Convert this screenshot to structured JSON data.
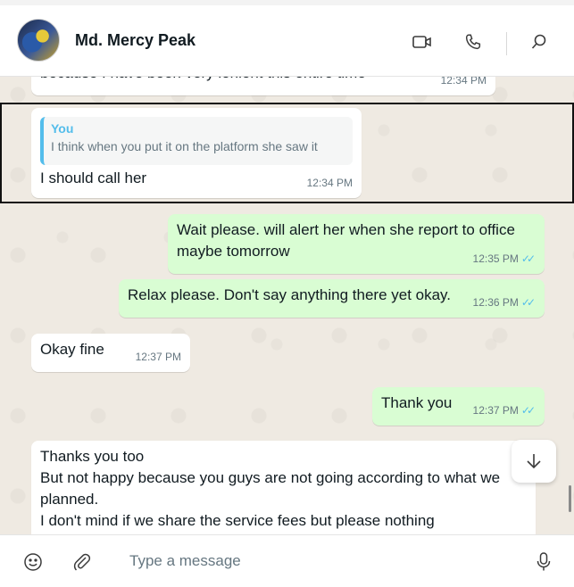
{
  "header": {
    "contact_name": "Md. Mercy Peak",
    "icons": [
      "video-call-icon",
      "voice-call-icon",
      "search-icon"
    ]
  },
  "messages": [
    {
      "direction": "in",
      "text": "because I have been very lenient this entire time",
      "time": "12:34 PM"
    },
    {
      "direction": "in",
      "quote_author": "You",
      "quote_text": "I think when you put it on the platform she saw it",
      "text": "I should call her",
      "time": "12:34 PM"
    },
    {
      "direction": "out",
      "text": "Wait please. will alert her when she report to office maybe tomorrow",
      "time": "12:35 PM",
      "status": "read"
    },
    {
      "direction": "out",
      "text": "Relax please. Don't say anything there yet okay.",
      "time": "12:36 PM",
      "status": "read"
    },
    {
      "direction": "in",
      "text": "Okay fine",
      "time": "12:37 PM"
    },
    {
      "direction": "out",
      "text": "Thank you",
      "time": "12:37 PM",
      "status": "read"
    },
    {
      "direction": "in",
      "lines": [
        "Thanks you too",
        "But not happy because you guys are not going according to what we",
        "planned.",
        "I don't mind if we share the service fees but please nothing"
      ]
    }
  ],
  "composer": {
    "placeholder": "Type a message",
    "icons": [
      "emoji-icon",
      "attach-icon",
      "microphone-icon"
    ]
  },
  "colors": {
    "incoming_bubble": "#ffffff",
    "outgoing_bubble": "#d9fdd3",
    "read_ticks": "#53bdeb",
    "background": "#efeae2"
  }
}
